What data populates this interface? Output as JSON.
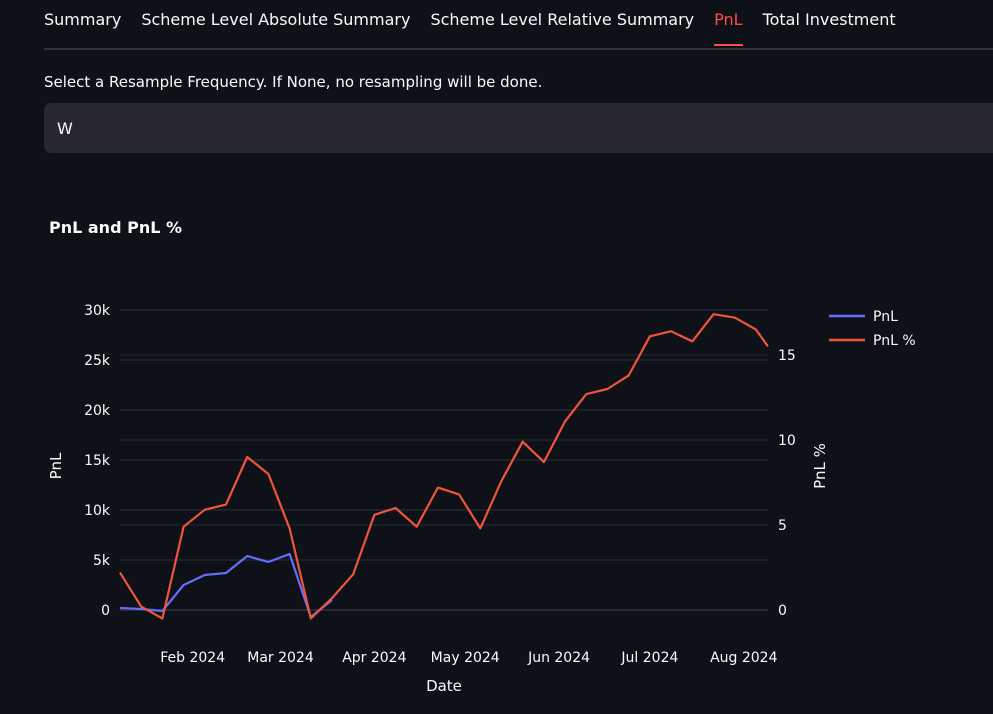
{
  "tabs": [
    {
      "label": "Summary",
      "active": false
    },
    {
      "label": "Scheme Level Absolute Summary",
      "active": false
    },
    {
      "label": "Scheme Level Relative Summary",
      "active": false
    },
    {
      "label": "PnL",
      "active": true
    },
    {
      "label": "Total Investment",
      "active": false
    }
  ],
  "resample": {
    "label": "Select a Resample Frequency. If None, no resampling will be done.",
    "selected": "W"
  },
  "colors": {
    "accent": "#ff4b4b",
    "pnl_line": "#636efa",
    "pnl_pct_line": "#ef553b"
  },
  "chart_data": {
    "type": "line",
    "title": "PnL and PnL %",
    "xlabel": "Date",
    "ylabel": "PnL",
    "y2label": "PnL %",
    "x_ticks": [
      "Feb 2024",
      "Mar 2024",
      "Apr 2024",
      "May 2024",
      "Jun 2024",
      "Jul 2024",
      "Aug 2024"
    ],
    "x_tick_days": [
      31,
      60,
      91,
      121,
      152,
      182,
      213
    ],
    "y_ticks": [
      0,
      5000,
      10000,
      15000,
      20000,
      25000,
      30000
    ],
    "y_tick_labels": [
      "0",
      "5k",
      "10k",
      "15k",
      "20k",
      "25k",
      "30k"
    ],
    "y2_ticks": [
      0,
      5,
      10,
      15
    ],
    "ylim": [
      -1000,
      30000
    ],
    "y2lim": [
      -0.6,
      17.6
    ],
    "xlim": [
      7,
      221
    ],
    "legend_position": "top-right",
    "grid": true,
    "series": [
      {
        "name": "PnL",
        "axis": "y",
        "x": [
          7,
          14,
          21,
          28,
          35,
          42,
          49,
          56,
          63,
          70,
          77
        ],
        "values": [
          200,
          100,
          -100,
          2500,
          3500,
          3700,
          5400,
          4800,
          5600,
          -700,
          1000
        ]
      },
      {
        "name": "PnL %",
        "axis": "y2",
        "x": [
          7,
          14,
          21,
          28,
          35,
          42,
          49,
          56,
          63,
          70,
          77,
          84,
          91,
          98,
          105,
          112,
          119,
          126,
          133,
          140,
          147,
          154,
          161,
          168,
          175,
          182,
          189,
          196,
          203,
          210,
          217,
          221
        ],
        "values": [
          2.2,
          0.2,
          -0.5,
          4.9,
          5.9,
          6.2,
          9.0,
          8.0,
          4.8,
          -0.5,
          0.7,
          2.1,
          5.6,
          6.0,
          4.9,
          7.2,
          6.8,
          4.8,
          7.6,
          9.9,
          8.7,
          11.1,
          12.7,
          13.0,
          13.8,
          16.1,
          16.4,
          15.8,
          17.4,
          17.2,
          16.5,
          15.5
        ]
      }
    ]
  }
}
